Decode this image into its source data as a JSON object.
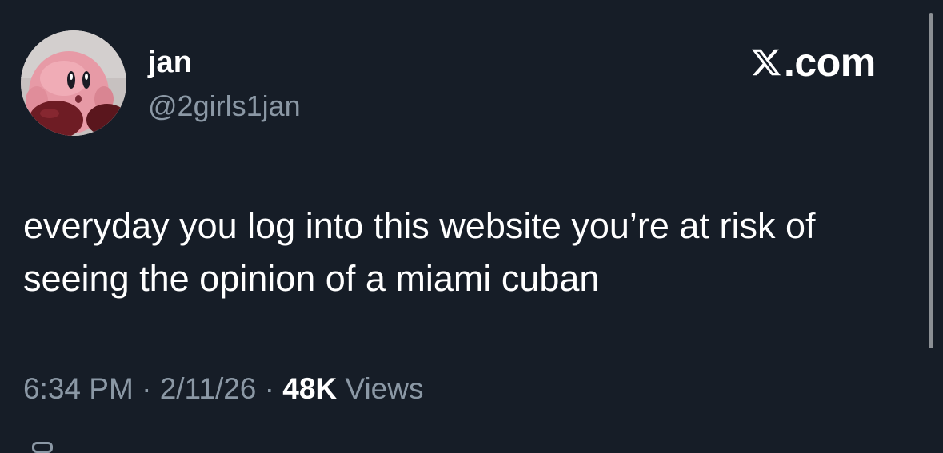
{
  "author": {
    "display_name": "jan",
    "handle": "@2girls1jan",
    "avatar_icon": "kirby-avatar"
  },
  "brand": {
    "domain": ".com",
    "icon": "x-logo-icon"
  },
  "tweet": {
    "text": "everyday you log into this website you’re at risk of seeing the opinion of a miami cuban"
  },
  "meta": {
    "time": "6:34 PM",
    "separator": "·",
    "date": "2/11/26",
    "views_count": "48K",
    "views_label": "Views"
  },
  "colors": {
    "background": "#161d27",
    "primary_text": "#ffffff",
    "secondary_text": "#8b98a5"
  }
}
